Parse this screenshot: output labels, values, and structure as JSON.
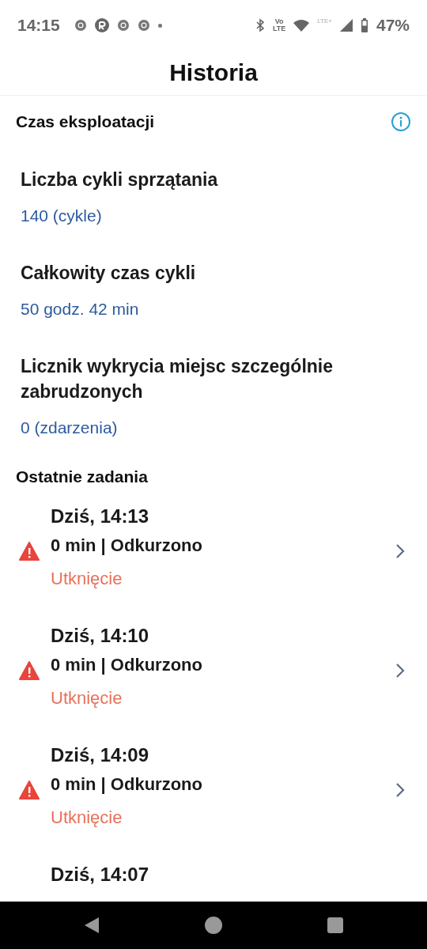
{
  "status_bar": {
    "time": "14:15",
    "volte_top": "Vo",
    "volte_bottom": "LTE",
    "network": "LTE+",
    "battery": "47%"
  },
  "header": {
    "title": "Historia"
  },
  "usage": {
    "title": "Czas eksploatacji",
    "stats": [
      {
        "label": "Liczba cykli sprzątania",
        "value": "140 (cykle)"
      },
      {
        "label": "Całkowity czas cykli",
        "value": "50 godz. 42 min"
      },
      {
        "label": "Licznik wykrycia miejsc szczególnie zabrudzonych",
        "value": "0 (zdarzenia)"
      }
    ]
  },
  "recent": {
    "title": "Ostatnie zadania",
    "tasks": [
      {
        "time": "Dziś, 14:13",
        "detail": "0 min | Odkurzono",
        "status": "Utknięcie",
        "warning": true
      },
      {
        "time": "Dziś, 14:10",
        "detail": "0 min | Odkurzono",
        "status": "Utknięcie",
        "warning": true
      },
      {
        "time": "Dziś, 14:09",
        "detail": "0 min | Odkurzono",
        "status": "Utknięcie",
        "warning": true
      },
      {
        "time": "Dziś, 14:07",
        "warning": false
      }
    ]
  }
}
